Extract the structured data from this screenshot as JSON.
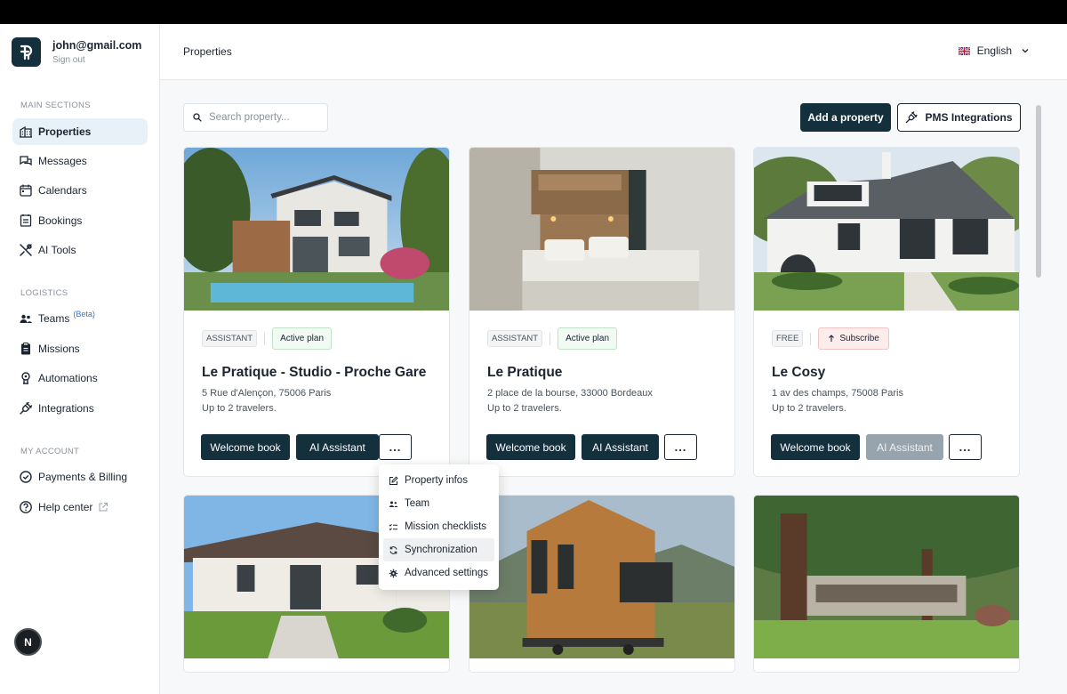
{
  "sidebar": {
    "user_email": "john@gmail.com",
    "signout": "Sign out",
    "sections": {
      "main": "MAIN SECTIONS",
      "logistics": "LOGISTICS",
      "account": "MY ACCOUNT"
    },
    "main_items": [
      {
        "label": "Properties",
        "icon": "building-icon",
        "active": true
      },
      {
        "label": "Messages",
        "icon": "chat-icon"
      },
      {
        "label": "Calendars",
        "icon": "calendar-icon"
      },
      {
        "label": "Bookings",
        "icon": "bookings-icon"
      },
      {
        "label": "AI Tools",
        "icon": "tools-icon"
      }
    ],
    "logistics_items": [
      {
        "label": "Teams",
        "badge": "(Beta)",
        "icon": "people-icon"
      },
      {
        "label": "Missions",
        "icon": "clipboard-icon"
      },
      {
        "label": "Automations",
        "icon": "robot-icon"
      },
      {
        "label": "Integrations",
        "icon": "plug-icon"
      }
    ],
    "account_items": [
      {
        "label": "Payments & Billing",
        "icon": "shield-check-icon"
      },
      {
        "label": "Help center",
        "icon": "help-icon"
      }
    ],
    "avatar_letter": "N"
  },
  "header": {
    "title": "Properties",
    "language": "English"
  },
  "toolbar": {
    "search_placeholder": "Search property...",
    "add_property": "Add a property",
    "pms_integrations": "PMS Integrations"
  },
  "cards": [
    {
      "plan": "ASSISTANT",
      "status": "Active plan",
      "title": "Le Pratique - Studio - Proche Gare",
      "address": "5 Rue d'Alençon, 75006 Paris",
      "travelers": "Up to 2 travelers.",
      "welcome_book": "Welcome book",
      "ai_assistant": "AI Assistant",
      "more": "..."
    },
    {
      "plan": "ASSISTANT",
      "status": "Active plan",
      "title": "Le Pratique",
      "address": "2 place de la bourse, 33000 Bordeaux",
      "travelers": "Up to 2 travelers.",
      "welcome_book": "Welcome book",
      "ai_assistant": "AI Assistant",
      "more": "..."
    },
    {
      "plan": "FREE",
      "status": "Subscribe",
      "title": "Le Cosy",
      "address": "1 av des champs, 75008 Paris",
      "travelers": "Up to 2 travelers.",
      "welcome_book": "Welcome book",
      "ai_assistant": "AI Assistant",
      "more": "..."
    }
  ],
  "dropdown": {
    "items": [
      {
        "label": "Property infos",
        "icon": "edit-icon"
      },
      {
        "label": "Team",
        "icon": "team-icon"
      },
      {
        "label": "Mission checklists",
        "icon": "checklist-icon"
      },
      {
        "label": "Synchronization",
        "icon": "sync-icon",
        "hovered": true
      },
      {
        "label": "Advanced settings",
        "icon": "gear-icon"
      }
    ]
  },
  "colors": {
    "primary": "#15303d",
    "active_nav_bg": "#e8f1f7",
    "active_plan_bg": "#f1faf3",
    "subscribe_bg": "#fdecec",
    "disabled_button": "#97a3ad"
  }
}
